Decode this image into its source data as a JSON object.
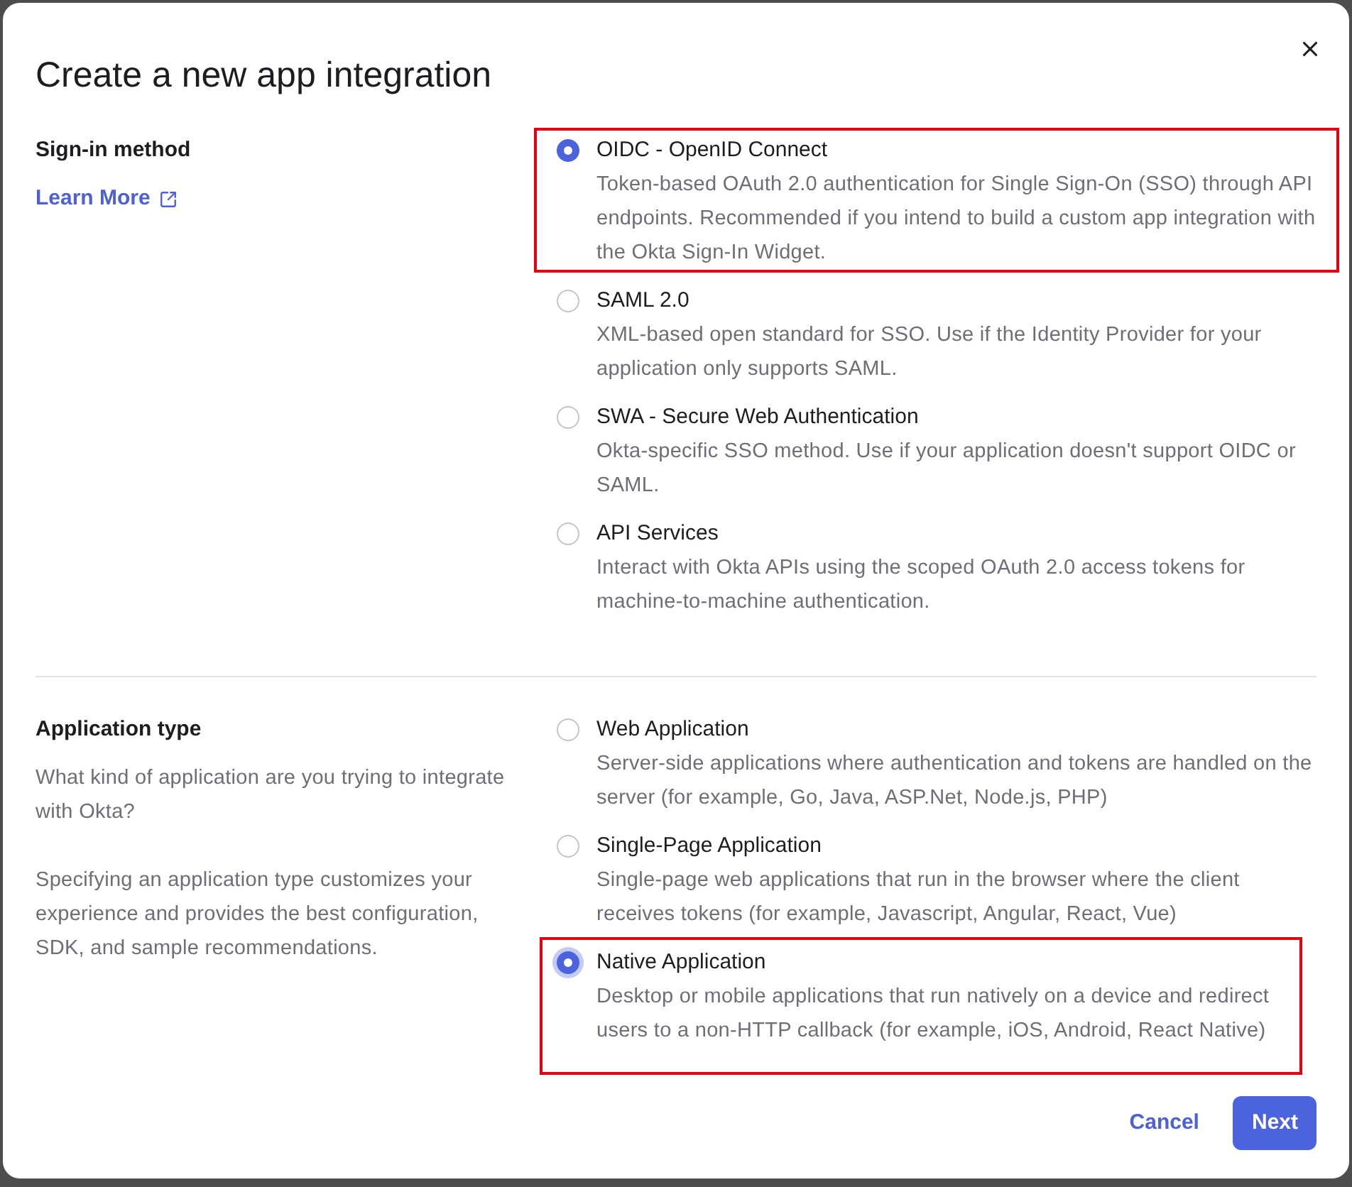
{
  "dialog": {
    "title": "Create a new app integration"
  },
  "sign_in_section": {
    "heading": "Sign-in method",
    "link": "Learn More",
    "options": [
      {
        "title": "OIDC - OpenID Connect",
        "description": "Token-based OAuth 2.0 authentication for Single Sign-On (SSO) through API endpoints. Recommended if you intend to build a custom app integration with the Okta Sign-In Widget.",
        "selected": true,
        "highlighted": true
      },
      {
        "title": "SAML 2.0",
        "description": "XML-based open standard for SSO. Use if the Identity Provider for your application only supports SAML.",
        "selected": false,
        "highlighted": false
      },
      {
        "title": "SWA - Secure Web Authentication",
        "description": "Okta-specific SSO method. Use if your application doesn't support OIDC or SAML.",
        "selected": false,
        "highlighted": false
      },
      {
        "title": "API Services",
        "description": "Interact with Okta APIs using the scoped OAuth 2.0 access tokens for machine-to-machine authentication.",
        "selected": false,
        "highlighted": false
      }
    ]
  },
  "application_type_section": {
    "heading": "Application type",
    "paragraphs": [
      "What kind of application are you trying to integrate with Okta?",
      "Specifying an application type customizes your experience and provides the best configuration, SDK, and sample recommendations."
    ],
    "options": [
      {
        "title": "Web Application",
        "description": "Server-side applications where authentication and tokens are handled on the server (for example, Go, Java, ASP.Net, Node.js, PHP)",
        "selected": false,
        "focused": false,
        "highlighted": false
      },
      {
        "title": "Single-Page Application",
        "description": "Single-page web applications that run in the browser where the client receives tokens (for example, Javascript, Angular, React, Vue)",
        "selected": false,
        "focused": false,
        "highlighted": false
      },
      {
        "title": "Native Application",
        "description": "Desktop or mobile applications that run natively on a device and redirect users to a non-HTTP callback (for example, iOS, Android, React Native)",
        "selected": true,
        "focused": true,
        "highlighted": true
      }
    ]
  },
  "footer": {
    "buttons": [
      {
        "label": "Cancel",
        "kind": "secondary"
      },
      {
        "label": "Next",
        "kind": "primary"
      }
    ]
  }
}
